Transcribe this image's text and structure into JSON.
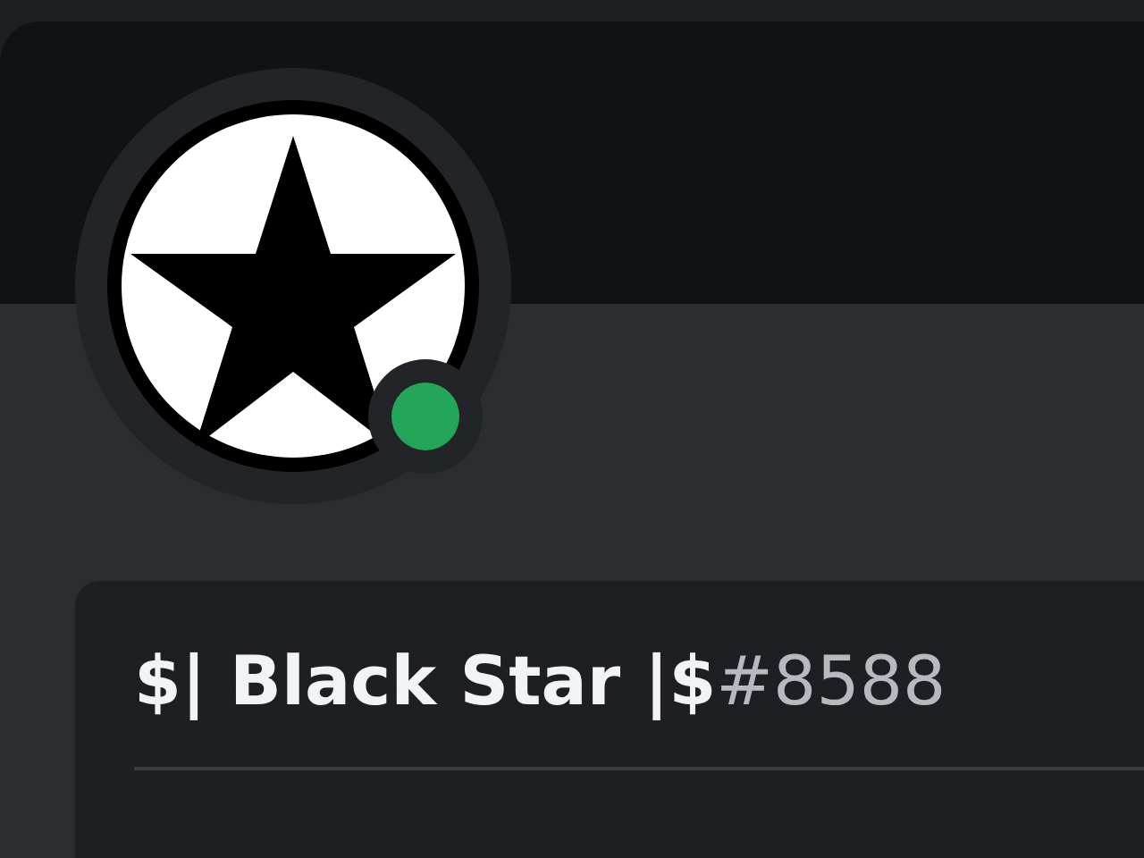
{
  "profile": {
    "display_name": "$| Black Star |$",
    "discriminator": "#8588",
    "online": true
  }
}
